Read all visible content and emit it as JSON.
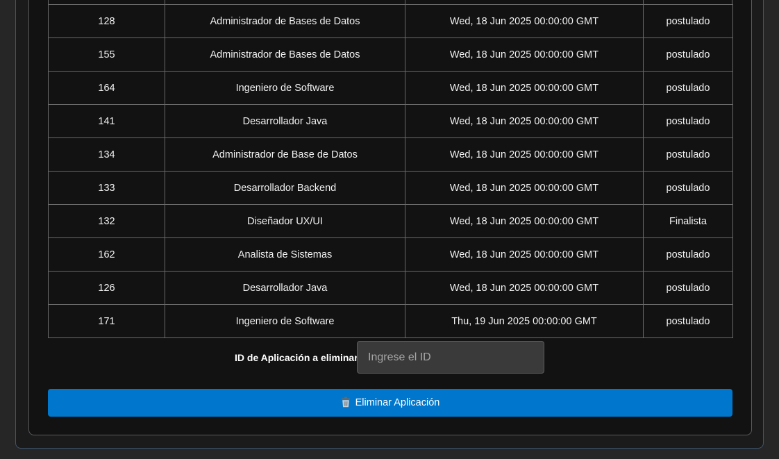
{
  "table": {
    "rows": [
      {
        "id": "128",
        "puesto": "Administrador de Bases de Datos",
        "fecha": "Wed, 18 Jun 2025 00:00:00 GMT",
        "estado": "postulado"
      },
      {
        "id": "155",
        "puesto": "Administrador de Bases de Datos",
        "fecha": "Wed, 18 Jun 2025 00:00:00 GMT",
        "estado": "postulado"
      },
      {
        "id": "164",
        "puesto": "Ingeniero de Software",
        "fecha": "Wed, 18 Jun 2025 00:00:00 GMT",
        "estado": "postulado"
      },
      {
        "id": "141",
        "puesto": "Desarrollador Java",
        "fecha": "Wed, 18 Jun 2025 00:00:00 GMT",
        "estado": "postulado"
      },
      {
        "id": "134",
        "puesto": "Administrador de Base de Datos",
        "fecha": "Wed, 18 Jun 2025 00:00:00 GMT",
        "estado": "postulado"
      },
      {
        "id": "133",
        "puesto": "Desarrollador Backend",
        "fecha": "Wed, 18 Jun 2025 00:00:00 GMT",
        "estado": "postulado"
      },
      {
        "id": "132",
        "puesto": "Diseñador UX/UI",
        "fecha": "Wed, 18 Jun 2025 00:00:00 GMT",
        "estado": "Finalista"
      },
      {
        "id": "162",
        "puesto": "Analista de Sistemas",
        "fecha": "Wed, 18 Jun 2025 00:00:00 GMT",
        "estado": "postulado"
      },
      {
        "id": "126",
        "puesto": "Desarrollador Java",
        "fecha": "Wed, 18 Jun 2025 00:00:00 GMT",
        "estado": "postulado"
      },
      {
        "id": "171",
        "puesto": "Ingeniero de Software",
        "fecha": "Thu, 19 Jun 2025 00:00:00 GMT",
        "estado": "postulado"
      }
    ]
  },
  "delete_form": {
    "label": "ID de Aplicación a eliminar:",
    "input_value": "",
    "input_placeholder": "Ingrese el ID",
    "button_label": "Eliminar Aplicación",
    "button_icon": "trash-icon"
  },
  "colors": {
    "button_blue": "#0077cc",
    "page_background": "#262626",
    "card_background": "#121212"
  }
}
